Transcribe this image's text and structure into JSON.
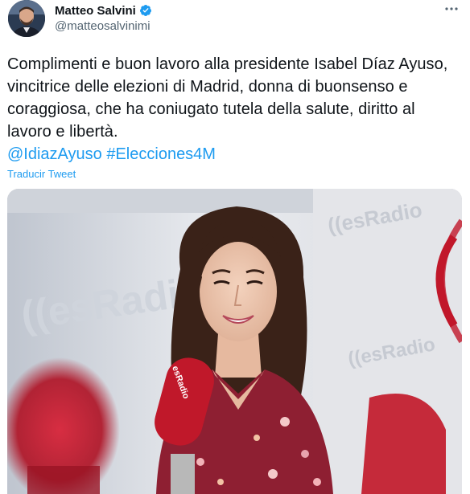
{
  "author": {
    "display_name": "Matteo Salvini",
    "handle": "@matteosalvinimi",
    "verified_icon": "verified-badge-icon"
  },
  "tweet": {
    "text": "Complimenti e buon lavoro alla presidente Isabel Díaz Ayuso, vincitrice delle elezioni di Madrid, donna di buonsenso e coraggiosa, che ha coniugato tutela della salute, diritto al lavoro e libertà.",
    "mention": "@IdiazAyuso",
    "hashtag": "#Elecciones4M",
    "translate_label": "Traducir Tweet"
  },
  "media": {
    "background_text_1": "((esRadio",
    "background_text_2": "((esRadio",
    "background_text_3": "((esRadio",
    "mic_label": "esRadio"
  },
  "colors": {
    "link": "#1d9bf0",
    "verified": "#1d9bf0",
    "text": "#0f1419",
    "secondary": "#536471",
    "brand_red": "#c0182a"
  }
}
